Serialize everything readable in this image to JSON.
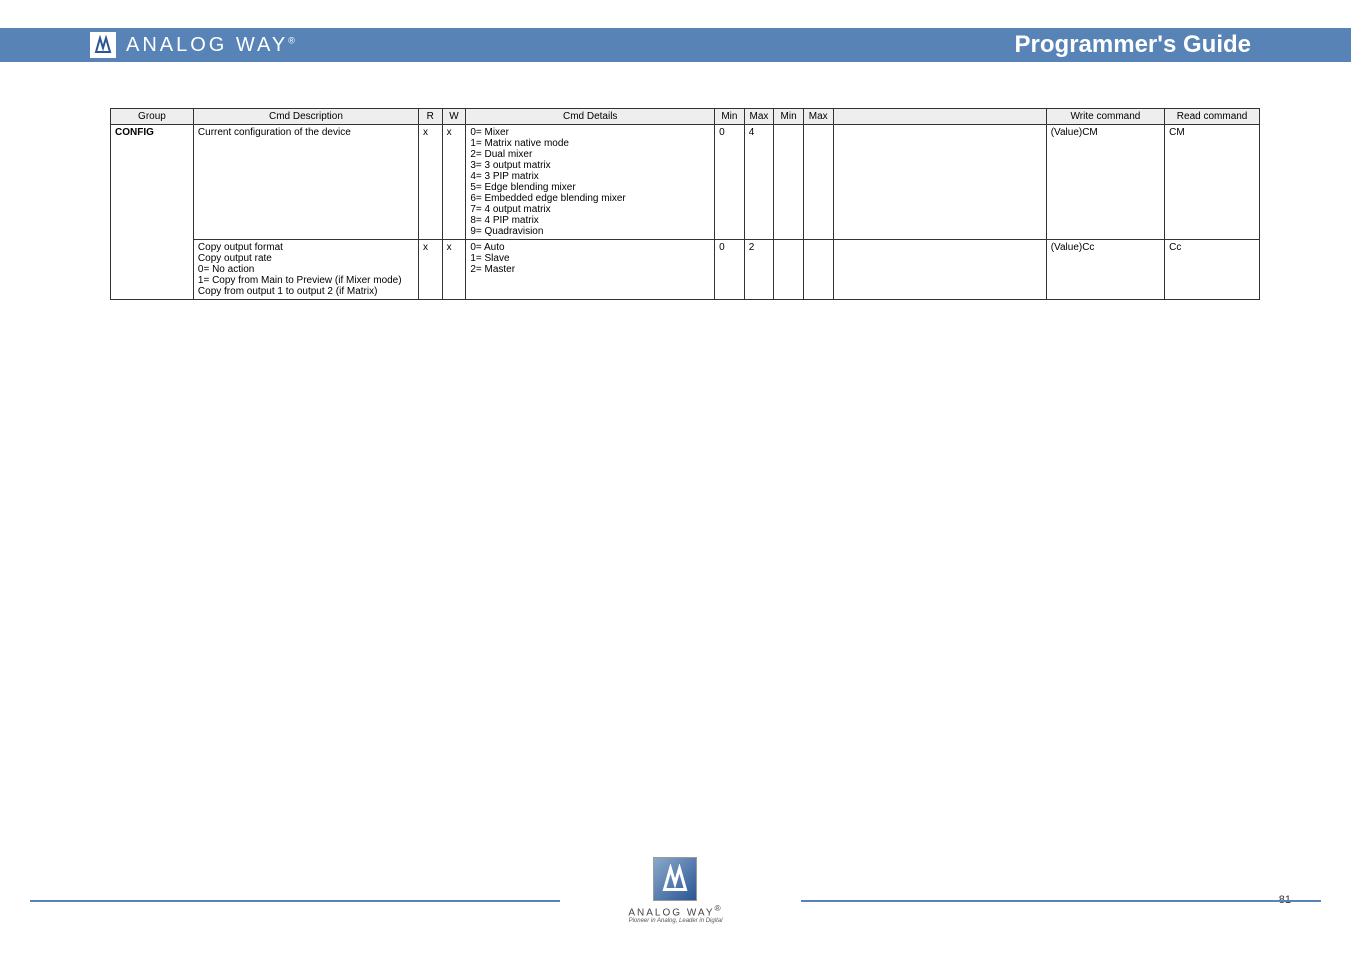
{
  "header": {
    "brand": "ANALOG WAY",
    "reg": "®",
    "title": "Programmer's Guide"
  },
  "table": {
    "headers": [
      "Group",
      "Cmd Description",
      "R",
      "W",
      "Cmd Details",
      "Min",
      "Max",
      "Min",
      "Max",
      "",
      "Write command",
      "Read command"
    ],
    "rows": [
      {
        "group": "CONFIG",
        "cmd_desc": "Current configuration of the device",
        "r": "x",
        "w": "x",
        "details": "0= Mixer\n1= Matrix native mode\n2= Dual mixer\n3= 3 output matrix\n4= 3 PIP matrix\n5= Edge blending mixer\n6= Embedded edge blending mixer\n7= 4 output matrix\n8= 4 PIP matrix\n9= Quadravision",
        "min1": "0",
        "max1": "4",
        "min2": "",
        "max2": "",
        "text": "",
        "write_cmd": "(Value)CM",
        "read_cmd": "CM"
      },
      {
        "group": "",
        "cmd_desc": "Copy output format\nCopy output rate\n0= No action\n1= Copy from Main to Preview (if Mixer mode)\nCopy from output 1 to output 2 (if Matrix)",
        "r": "x",
        "w": "x",
        "details": "0= Auto\n1= Slave\n2= Master",
        "min1": "0",
        "max1": "2",
        "min2": "",
        "max2": "",
        "text": "",
        "write_cmd": "(Value)Cc",
        "read_cmd": "Cc"
      }
    ]
  },
  "footer": {
    "brand": "ANALOG WAY",
    "reg": "®",
    "tag": "Pioneer in Analog, Leader in Digital"
  },
  "page": "81"
}
